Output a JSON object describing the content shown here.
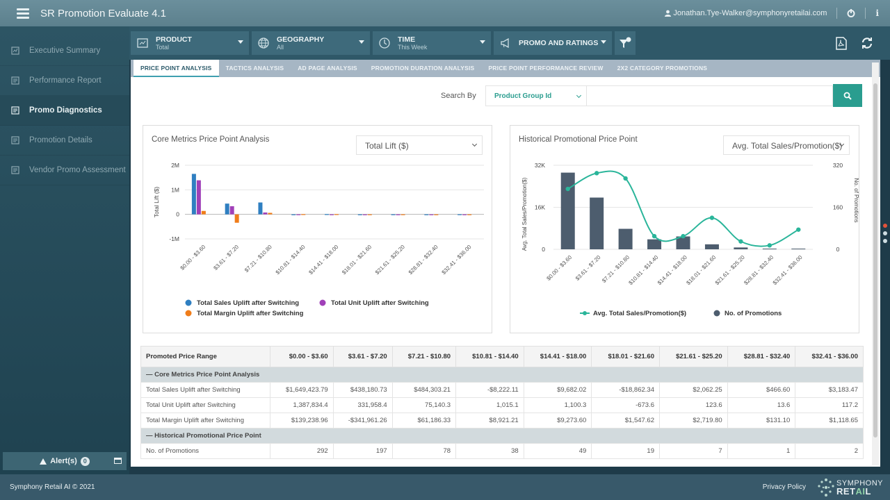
{
  "app": {
    "title": "SR Promotion Evaluate 4.1",
    "user": "Jonathan.Tye-Walker@symphonyretailai.com",
    "info_label": "i"
  },
  "sidebar": {
    "items": [
      {
        "label": "Executive Summary"
      },
      {
        "label": "Performance Report"
      },
      {
        "label": "Promo Diagnostics"
      },
      {
        "label": "Promotion Details"
      },
      {
        "label": "Vendor Promo Assessment"
      }
    ],
    "alerts_label": "Alert(s)",
    "alerts_count": "0"
  },
  "filters": {
    "product": {
      "label": "PRODUCT",
      "value": "Total"
    },
    "geography": {
      "label": "GEOGRAPHY",
      "value": "All"
    },
    "time": {
      "label": "TIME",
      "value": "This Week"
    },
    "promo": {
      "label": "PROMO AND RATINGS",
      "value": ""
    }
  },
  "tabs": [
    "PRICE POINT ANALYSIS",
    "TACTICS ANALYSIS",
    "AD PAGE ANALYSIS",
    "PROMOTION DURATION ANALYSIS",
    "PRICE POINT PERFORMANCE REVIEW",
    "2X2 CATEGORY PROMOTIONS"
  ],
  "search": {
    "label": "Search By",
    "selected": "Product Group Id",
    "value": ""
  },
  "panels": {
    "left": {
      "title": "Core Metrics Price Point Analysis",
      "dropdown": "Total Lift ($)"
    },
    "right": {
      "title": "Historical Promotional Price Point",
      "dropdown": "Avg. Total Sales/Promotion($)"
    }
  },
  "chart_data": [
    {
      "type": "bar",
      "title": "Core Metrics Price Point Analysis",
      "ylabel": "Total Lift ($)",
      "ylim": [
        -1000000,
        2000000
      ],
      "yticks": [
        "2M",
        "1M",
        "0",
        "-1M"
      ],
      "categories": [
        "$0.00 - $3.60",
        "$3.61 - $7.20",
        "$7.21 - $10.80",
        "$10.81 - $14.40",
        "$14.41 - $18.00",
        "$18.01 - $21.60",
        "$21.61 - $25.20",
        "$28.81 - $32.40",
        "$32.41 - $36.00"
      ],
      "series": [
        {
          "name": "Total Sales Uplift after Switching",
          "color": "#2f7fc1",
          "values": [
            1649423.79,
            438180.73,
            484303.21,
            -8222.11,
            9682.02,
            -18862.34,
            2062.25,
            466.6,
            3183.47
          ]
        },
        {
          "name": "Total Unit Uplift after Switching",
          "color": "#a040b8",
          "values": [
            1387834.4,
            331958.4,
            75140.3,
            1015.1,
            1100.3,
            -673.6,
            123.6,
            13.6,
            117.2
          ]
        },
        {
          "name": "Total Margin Uplift after Switching",
          "color": "#f07d1a",
          "values": [
            139238.96,
            -341961.26,
            61186.33,
            8921.21,
            9273.6,
            1547.62,
            2719.8,
            131.1,
            1118.65
          ]
        }
      ],
      "legend": "bottom"
    },
    {
      "type": "bar",
      "title": "Historical Promotional Price Point",
      "ylabel": "Avg. Total Sales/Promotion($)",
      "y2label": "No. of Promotions",
      "ylim": [
        0,
        32000
      ],
      "yticks": [
        "32K",
        "16K",
        "0"
      ],
      "y2lim": [
        0,
        320
      ],
      "y2ticks": [
        "320",
        "160",
        "0"
      ],
      "categories": [
        "$0.00 - $3.60",
        "$3.61 - $7.20",
        "$7.21 - $10.80",
        "$10.81 - $14.40",
        "$14.41 - $18.00",
        "$18.01 - $21.60",
        "$21.61 - $25.20",
        "$28.81 - $32.40",
        "$32.41 - $36.00"
      ],
      "series": [
        {
          "name": "Avg. Total Sales/Promotion($)",
          "type": "line",
          "color": "#2ab59a",
          "values": [
            23000,
            29000,
            27000,
            5000,
            5000,
            12000,
            3000,
            1500,
            7500
          ]
        },
        {
          "name": "No. of Promotions",
          "type": "bar",
          "color": "#4d5d6e",
          "values": [
            292,
            197,
            78,
            38,
            49,
            19,
            7,
            1,
            2
          ]
        }
      ],
      "legend": "bottom"
    }
  ],
  "table": {
    "header": [
      "Promoted Price Range",
      "$0.00 - $3.60",
      "$3.61 - $7.20",
      "$7.21 - $10.80",
      "$10.81 - $14.40",
      "$14.41 - $18.00",
      "$18.01 - $21.60",
      "$21.61 - $25.20",
      "$28.81 - $32.40",
      "$32.41 - $36.00"
    ],
    "groups": [
      {
        "label": "Core Metrics Price Point Analysis",
        "rows": [
          [
            "Total Sales Uplift after Switching",
            "$1,649,423.79",
            "$438,180.73",
            "$484,303.21",
            "-$8,222.11",
            "$9,682.02",
            "-$18,862.34",
            "$2,062.25",
            "$466.60",
            "$3,183.47"
          ],
          [
            "Total Unit Uplift after Switching",
            "1,387,834.4",
            "331,958.4",
            "75,140.3",
            "1,015.1",
            "1,100.3",
            "-673.6",
            "123.6",
            "13.6",
            "117.2"
          ],
          [
            "Total Margin Uplift after Switching",
            "$139,238.96",
            "-$341,961.26",
            "$61,186.33",
            "$8,921.21",
            "$9,273.60",
            "$1,547.62",
            "$2,719.80",
            "$131.10",
            "$1,118.65"
          ]
        ]
      },
      {
        "label": "Historical Promotional Price Point",
        "rows": [
          [
            "No. of Promotions",
            "292",
            "197",
            "78",
            "38",
            "49",
            "19",
            "7",
            "1",
            "2"
          ]
        ]
      }
    ]
  },
  "footer": {
    "copyright": "Symphony Retail AI © 2021",
    "privacy": "Privacy Policy",
    "logo_top": "SYMPHONY",
    "logo_bottom_a": "RET",
    "logo_bottom_b": "AI",
    "logo_bottom_c": "L"
  }
}
